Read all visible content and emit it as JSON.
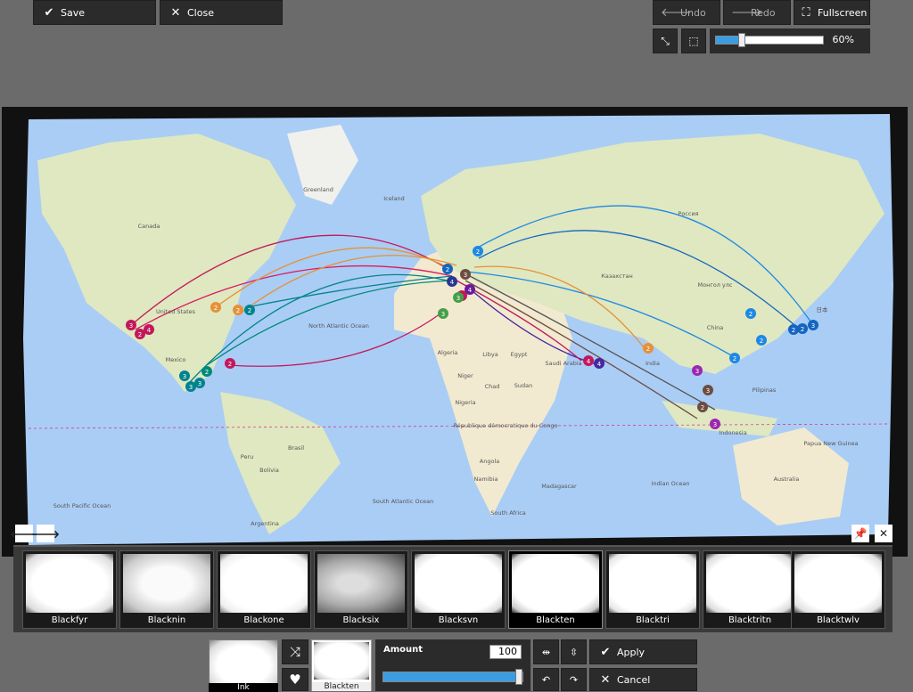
{
  "toolbar": {
    "save_label": "Save",
    "close_label": "Close",
    "undo_label": "Undo",
    "redo_label": "Redo",
    "fullscreen_label": "Fullscreen"
  },
  "zoom": {
    "value": 60,
    "label": "60%"
  },
  "map_text": {
    "canada": "Canada",
    "united_states": "United States",
    "mexico": "Mexico",
    "brasil": "Brasil",
    "peru": "Peru",
    "bolivia": "Bolivia",
    "argentina": "Argentina",
    "north_atlantic": "North Atlantic Ocean",
    "south_atlantic": "South Atlantic Ocean",
    "south_pacific": "South Pacific Ocean",
    "indian_ocean": "Indian Ocean",
    "greenland": "Greenland",
    "iceland": "Iceland",
    "russia": "Россия",
    "kazakhstan": "Казахстан",
    "mongolia": "Монгол улс",
    "china": "China",
    "india": "India",
    "algeria": "Algeria",
    "libya": "Libya",
    "egypt": "Egypt",
    "niger": "Niger",
    "chad": "Chad",
    "sudan": "Sudan",
    "nigeria": "Nigeria",
    "drc": "République démocratique du Congo",
    "angola": "Angola",
    "namibia": "Namibia",
    "south_africa": "South Africa",
    "madagascar": "Madagascar",
    "indonesia": "Indonesia",
    "australia": "Australia",
    "saudi_arabia": "Saudi Arabia",
    "japan": "日本",
    "papua": "Papua New Guinea",
    "philippines": "Pilipinas"
  },
  "filters": [
    {
      "label": "Blackfyr",
      "selected": false
    },
    {
      "label": "Blacknin",
      "selected": false
    },
    {
      "label": "Blackone",
      "selected": false
    },
    {
      "label": "Blacksix",
      "selected": false
    },
    {
      "label": "Blacksvn",
      "selected": false
    },
    {
      "label": "Blackten",
      "selected": true
    },
    {
      "label": "Blacktri",
      "selected": false
    },
    {
      "label": "Blacktritn",
      "selected": false
    },
    {
      "label": "Blacktwlv",
      "selected": false
    }
  ],
  "edit": {
    "ink_label": "Ink",
    "current_label": "Blackten",
    "amount_label": "Amount",
    "amount_value": "100",
    "amount_fraction": 1.0,
    "apply_label": "Apply",
    "cancel_label": "Cancel"
  },
  "colors": {
    "accent": "#3a9de2",
    "panel": "#2b2b2b",
    "background": "#6b6b6b",
    "ocean": "#aacdf5",
    "land": "#dfe8c0",
    "desert": "#f2ead0"
  },
  "icons": [
    "check-icon",
    "close-icon",
    "undo-arrow-icon",
    "redo-arrow-icon",
    "fullscreen-icon",
    "shrink-icon",
    "crop-icon",
    "left-arrow-icon",
    "right-arrow-icon",
    "pin-icon",
    "shuffle-icon",
    "heart-icon",
    "flip-horizontal-icon",
    "flip-vertical-icon",
    "rotate-left-icon",
    "rotate-right-icon"
  ]
}
